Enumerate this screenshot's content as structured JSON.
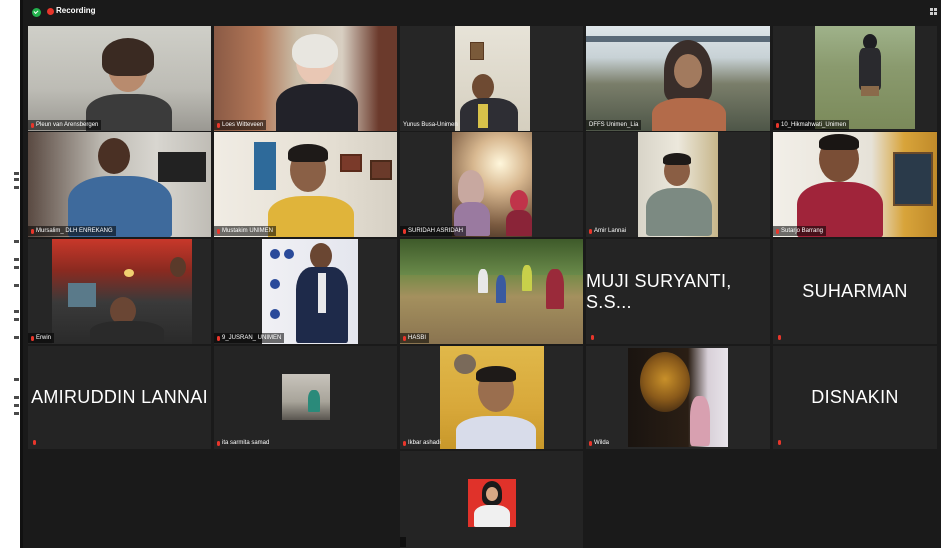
{
  "recording": {
    "label": "Recording"
  },
  "participants": [
    {
      "name": "Pleun van Arensbergen"
    },
    {
      "name": "Loes Witteveen"
    },
    {
      "name": "Yunus Busa-Unimen"
    },
    {
      "name": "DFFS Unimen_Lia"
    },
    {
      "name": "10_Hikmahwati_Unimen"
    },
    {
      "name": "Mursalim_ DLH ENREKANG"
    },
    {
      "name": "Mustakim UNIMEN"
    },
    {
      "name": "SURIDAH ASRIDAH"
    },
    {
      "name": "Amir Lannai"
    },
    {
      "name": "Sutarjo Barrang"
    },
    {
      "name": "Erwin"
    },
    {
      "name": "9_JUSRAN_ UNIMEN"
    },
    {
      "name": "HASBI"
    },
    {
      "name": "MUJI SURYANTI, S.S..."
    },
    {
      "name": "SUHARMAN"
    },
    {
      "name": "AMIRUDDIN LANNAI"
    },
    {
      "name": "ita sarmita samad"
    },
    {
      "name": "Ikbar ashadi"
    },
    {
      "name": "Wilda"
    },
    {
      "name": "DISNAKIN"
    },
    {
      "name": ""
    }
  ],
  "colors": {
    "background": "#1a1a1a",
    "tile": "#242424",
    "active_speaker": "#e1d96a",
    "mic_muted": "#e8362b"
  }
}
